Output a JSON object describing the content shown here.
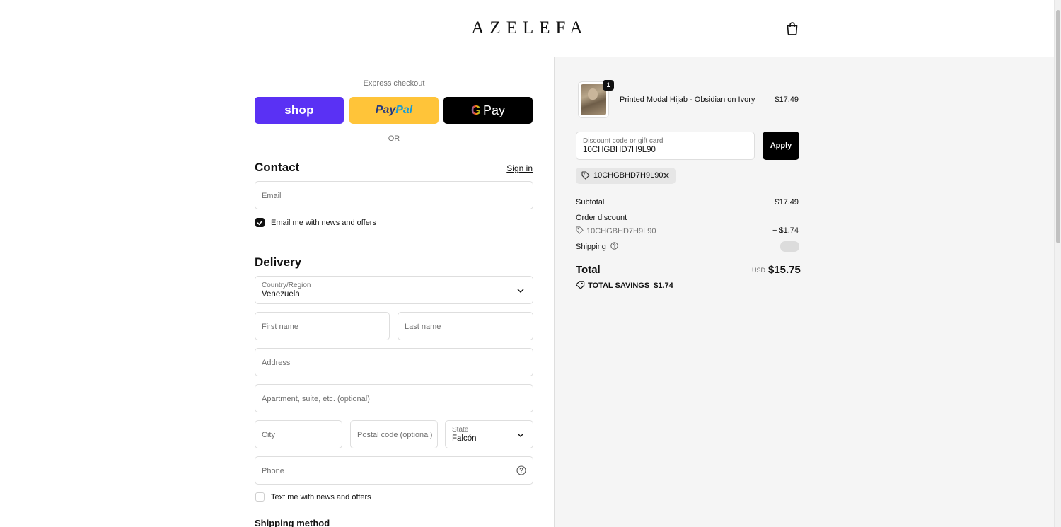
{
  "header": {
    "logo": "AZELEFA",
    "cart_icon": "shopping-bag-icon"
  },
  "express": {
    "title": "Express checkout",
    "shop_label": "shop",
    "paypal_part1": "Pay",
    "paypal_part2": "Pal",
    "gpay_g": "G",
    "gpay_label": "Pay",
    "or_label": "OR"
  },
  "contact": {
    "heading": "Contact",
    "sign_in": "Sign in",
    "email_placeholder": "Email",
    "email_offers_label": "Email me with news and offers",
    "email_offers_checked": true
  },
  "delivery": {
    "heading": "Delivery",
    "country_label": "Country/Region",
    "country_value": "Venezuela",
    "first_name_placeholder": "First name",
    "last_name_placeholder": "Last name",
    "address_placeholder": "Address",
    "apartment_placeholder": "Apartment, suite, etc. (optional)",
    "city_placeholder": "City",
    "postal_placeholder": "Postal code (optional)",
    "state_label": "State",
    "state_value": "Falcón",
    "phone_placeholder": "Phone",
    "text_offers_label": "Text me with news and offers",
    "text_offers_checked": false
  },
  "shipping_method": {
    "heading": "Shipping method"
  },
  "summary": {
    "item": {
      "name": "Printed Modal Hijab - Obsidian on Ivory",
      "price": "$17.49",
      "quantity": "1"
    },
    "discount_label": "Discount code or gift card",
    "discount_value": "10CHGBHD7H9L90",
    "apply_label": "Apply",
    "applied_code": "10CHGBHD7H9L90",
    "subtotal_label": "Subtotal",
    "subtotal_value": "$17.49",
    "order_discount_label": "Order discount",
    "order_discount_code": "10CHGBHD7H9L90",
    "order_discount_value": "− $1.74",
    "shipping_label": "Shipping",
    "total_label": "Total",
    "total_currency": "USD",
    "total_value": "$15.75",
    "savings_label": "TOTAL SAVINGS",
    "savings_value": "$1.74"
  },
  "colors": {
    "shop_purple": "#5a31f4",
    "paypal_yellow": "#ffc439",
    "panel_bg": "#f5f5f5",
    "border": "#dedede"
  }
}
